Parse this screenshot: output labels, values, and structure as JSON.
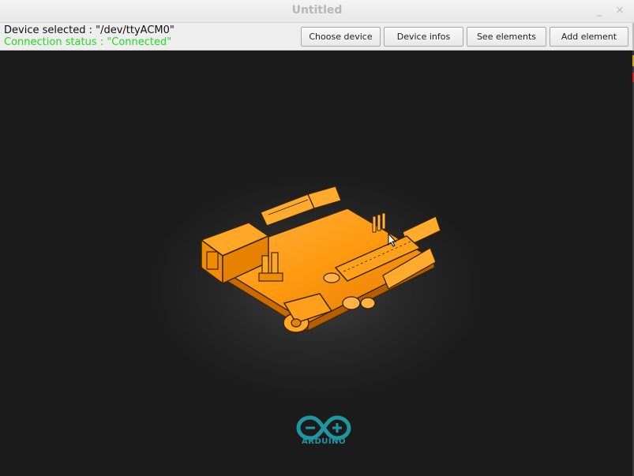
{
  "window": {
    "title": "Untitled",
    "minimize_glyph": "_",
    "close_glyph": "×"
  },
  "status": {
    "device_selected": "Device selected : \"/dev/ttyACM0\"",
    "connection_status": "Connection status : \"Connected\""
  },
  "toolbar": {
    "choose_device": "Choose device",
    "device_infos": "Device infos",
    "see_elements": "See elements",
    "add_element": "Add element"
  },
  "canvas": {
    "model": "arduino-board-3d-icon",
    "logo_text": "ARDUINO"
  },
  "colors": {
    "background": "#1b1b1b",
    "board_orange": "#ff9800",
    "connected_green": "#22dd22",
    "logo_teal": "#1f96a0"
  }
}
